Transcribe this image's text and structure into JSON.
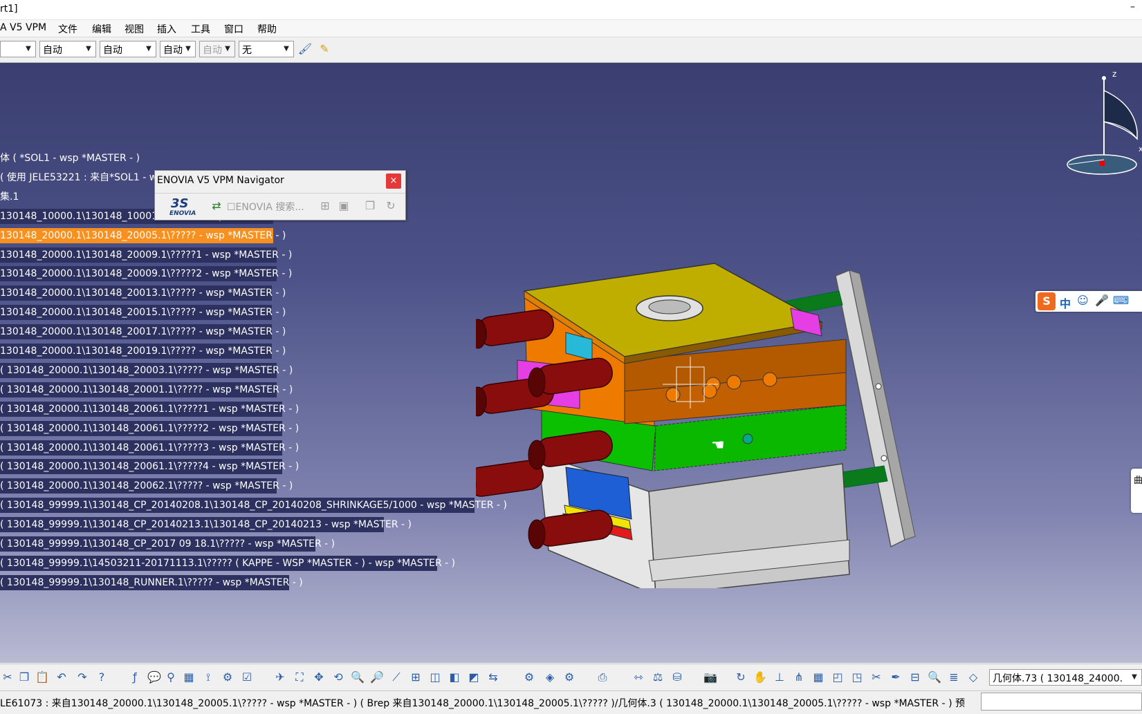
{
  "window": {
    "title": "rt1]",
    "minimize": "–"
  },
  "menu": [
    "A V5 VPM",
    "文件",
    "编辑",
    "视图",
    "插入",
    "工具",
    "窗口",
    "帮助"
  ],
  "toolbar_top": {
    "combos": [
      "",
      "自动",
      "自动",
      "自动",
      "自动",
      "无"
    ],
    "disabled_index": 4
  },
  "navigator": {
    "title": "ENOVIA V5 VPM Navigator",
    "close": "×",
    "logo_ds": "3S",
    "logo_text": "ENOVIA",
    "search_label": "☐ENOVIA 搜索..."
  },
  "tree": [
    {
      "text": "体 ( *SOL1 - wsp *MASTER - )",
      "style": "plain"
    },
    {
      "text": "( 使用 JELE53221 : 来自*SOL1 - wsp *MASTER - ) ( Brep 来自*SOL1 )",
      "style": "plain"
    },
    {
      "text": "集.1",
      "style": "plain"
    },
    {
      "text": " 130148_10000.1\\130148_10001.1\\????? - wsp *MASTER - )",
      "style": "hl"
    },
    {
      "text": " 130148_20000.1\\130148_20005.1\\????? - wsp *MASTER - )",
      "style": "sel"
    },
    {
      "text": " 130148_20000.1\\130148_20009.1\\?????1 - wsp *MASTER - )",
      "style": "hl"
    },
    {
      "text": " 130148_20000.1\\130148_20009.1\\?????2 - wsp *MASTER - )",
      "style": "hl"
    },
    {
      "text": " 130148_20000.1\\130148_20013.1\\????? - wsp *MASTER - )",
      "style": "hl"
    },
    {
      "text": " 130148_20000.1\\130148_20015.1\\????? - wsp *MASTER - )",
      "style": "hl"
    },
    {
      "text": " 130148_20000.1\\130148_20017.1\\????? - wsp *MASTER - )",
      "style": "hl"
    },
    {
      "text": " 130148_20000.1\\130148_20019.1\\????? - wsp *MASTER - )",
      "style": "hl"
    },
    {
      "text": " ( 130148_20000.1\\130148_20003.1\\????? - wsp *MASTER - )",
      "style": "hl"
    },
    {
      "text": " ( 130148_20000.1\\130148_20001.1\\????? - wsp *MASTER - )",
      "style": "hl"
    },
    {
      "text": " ( 130148_20000.1\\130148_20061.1\\?????1 - wsp *MASTER - )",
      "style": "hl"
    },
    {
      "text": " ( 130148_20000.1\\130148_20061.1\\?????2 - wsp *MASTER - )",
      "style": "hl"
    },
    {
      "text": " ( 130148_20000.1\\130148_20061.1\\?????3 - wsp *MASTER - )",
      "style": "hl"
    },
    {
      "text": " ( 130148_20000.1\\130148_20061.1\\?????4 - wsp *MASTER - )",
      "style": "hl"
    },
    {
      "text": " ( 130148_20000.1\\130148_20062.1\\????? - wsp *MASTER - )",
      "style": "hl"
    },
    {
      "text": " ( 130148_99999.1\\130148_CP_20140208.1\\130148_CP_20140208_SHRINKAGE5/1000 - wsp *MASTER - )",
      "style": "hl"
    },
    {
      "text": " ( 130148_99999.1\\130148_CP_20140213.1\\130148_CP_20140213 - wsp *MASTER - )",
      "style": "hl"
    },
    {
      "text": " ( 130148_99999.1\\130148_CP_2017 09 18.1\\????? - wsp *MASTER - )",
      "style": "hl"
    },
    {
      "text": " ( 130148_99999.1\\14503211-20171113.1\\????? ( KAPPE - WSP *MASTER - ) - wsp *MASTER - )",
      "style": "hl"
    },
    {
      "text": " ( 130148_99999.1\\130148_RUNNER.1\\????? - wsp *MASTER - )",
      "style": "hl"
    }
  ],
  "compass": {
    "z": "z",
    "x": "x"
  },
  "ime": {
    "logo": "S",
    "lang": "中"
  },
  "side_tab": "曲",
  "bottom_combo": "几何体.73 ( 130148_24000.",
  "status": "LE61073 : 来自130148_20000.1\\130148_20005.1\\????? - wsp *MASTER - ) ( Brep 来自130148_20000.1\\130148_20005.1\\????? )/几何体.3 ( 130148_20000.1\\130148_20005.1\\????? - wsp *MASTER - ) 预",
  "colors": {
    "viewport_top": "#3a3e70",
    "viewport_bottom": "#b9bbd3",
    "selection": "#f7901e",
    "tree_highlight": "#2d3160"
  }
}
